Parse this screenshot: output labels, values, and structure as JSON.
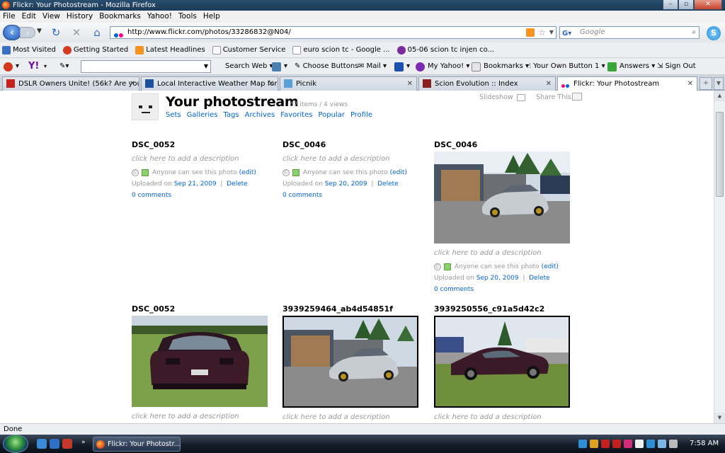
{
  "window": {
    "title": "Flickr: Your Photostream - Mozilla Firefox"
  },
  "menu": [
    "File",
    "Edit",
    "View",
    "History",
    "Bookmarks",
    "Yahoo!",
    "Tools",
    "Help"
  ],
  "nav": {
    "url": "http://www.flickr.com/photos/33286832@N04/",
    "search_placeholder": "Google"
  },
  "bookmarks": [
    {
      "label": "Most Visited",
      "icon": "star-icon",
      "color": "#3a6fc4"
    },
    {
      "label": "Getting Started",
      "icon": "firefox-icon",
      "color": "#d23b1e"
    },
    {
      "label": "Latest Headlines",
      "icon": "rss-icon",
      "color": "#f7931e"
    },
    {
      "label": "Customer Service",
      "icon": "page-icon",
      "color": "#ffffff"
    },
    {
      "label": "euro scion tc - Google ...",
      "icon": "page-icon",
      "color": "#ffffff"
    },
    {
      "label": "05-06 scion tc injen co...",
      "icon": "peace-icon",
      "color": "#7a2b9c"
    }
  ],
  "toolbar": {
    "search_web": "Search Web",
    "choose_buttons": "Choose Buttons",
    "mail": "Mail",
    "my_yahoo": "My Yahoo!",
    "bookmarks": "Bookmarks",
    "your_button": "Your Own Button 1",
    "answers": "Answers",
    "sign_out": "Sign Out"
  },
  "tabs": [
    {
      "label": "DSLR Owners Unite! (56k? Are you ...",
      "color": "#c42020"
    },
    {
      "label": "Local Interactive Weather Map for ...",
      "color": "#1c4f9c"
    },
    {
      "label": "Picnik",
      "color": "#5aa0d8"
    },
    {
      "label": "Scion Evolution :: Index",
      "color": "#8a1f1f"
    },
    {
      "label": "Flickr: Your Photostream",
      "color": "#ff0084"
    }
  ],
  "page": {
    "title": "Your photostream",
    "meta": "67 items / 4 views",
    "nav": [
      "Sets",
      "Galleries",
      "Tags",
      "Archives",
      "Favorites",
      "Popular",
      "Profile"
    ],
    "slideshow": "Slideshow",
    "share": "Share This"
  },
  "photo_strings": {
    "desc": "click here to add a description",
    "perm_text": "Anyone can see this photo",
    "edit": "(edit)",
    "uploaded_on": "Uploaded on",
    "delete": "Delete",
    "comments": "0 comments"
  },
  "photos": [
    {
      "title": "DSC_0052",
      "date": "Sep 21, 2009"
    },
    {
      "title": "DSC_0046",
      "date": "Sep 20, 2009"
    },
    {
      "title": "DSC_0046",
      "date": "Sep 20, 2009"
    },
    {
      "title": "DSC_0052"
    },
    {
      "title": "3939259464_ab4d54851f"
    },
    {
      "title": "3939250556_c91a5d42c2"
    }
  ],
  "status": "Done",
  "taskbar": {
    "window": "Flickr: Your Photostr...",
    "time": "7:58 AM"
  }
}
